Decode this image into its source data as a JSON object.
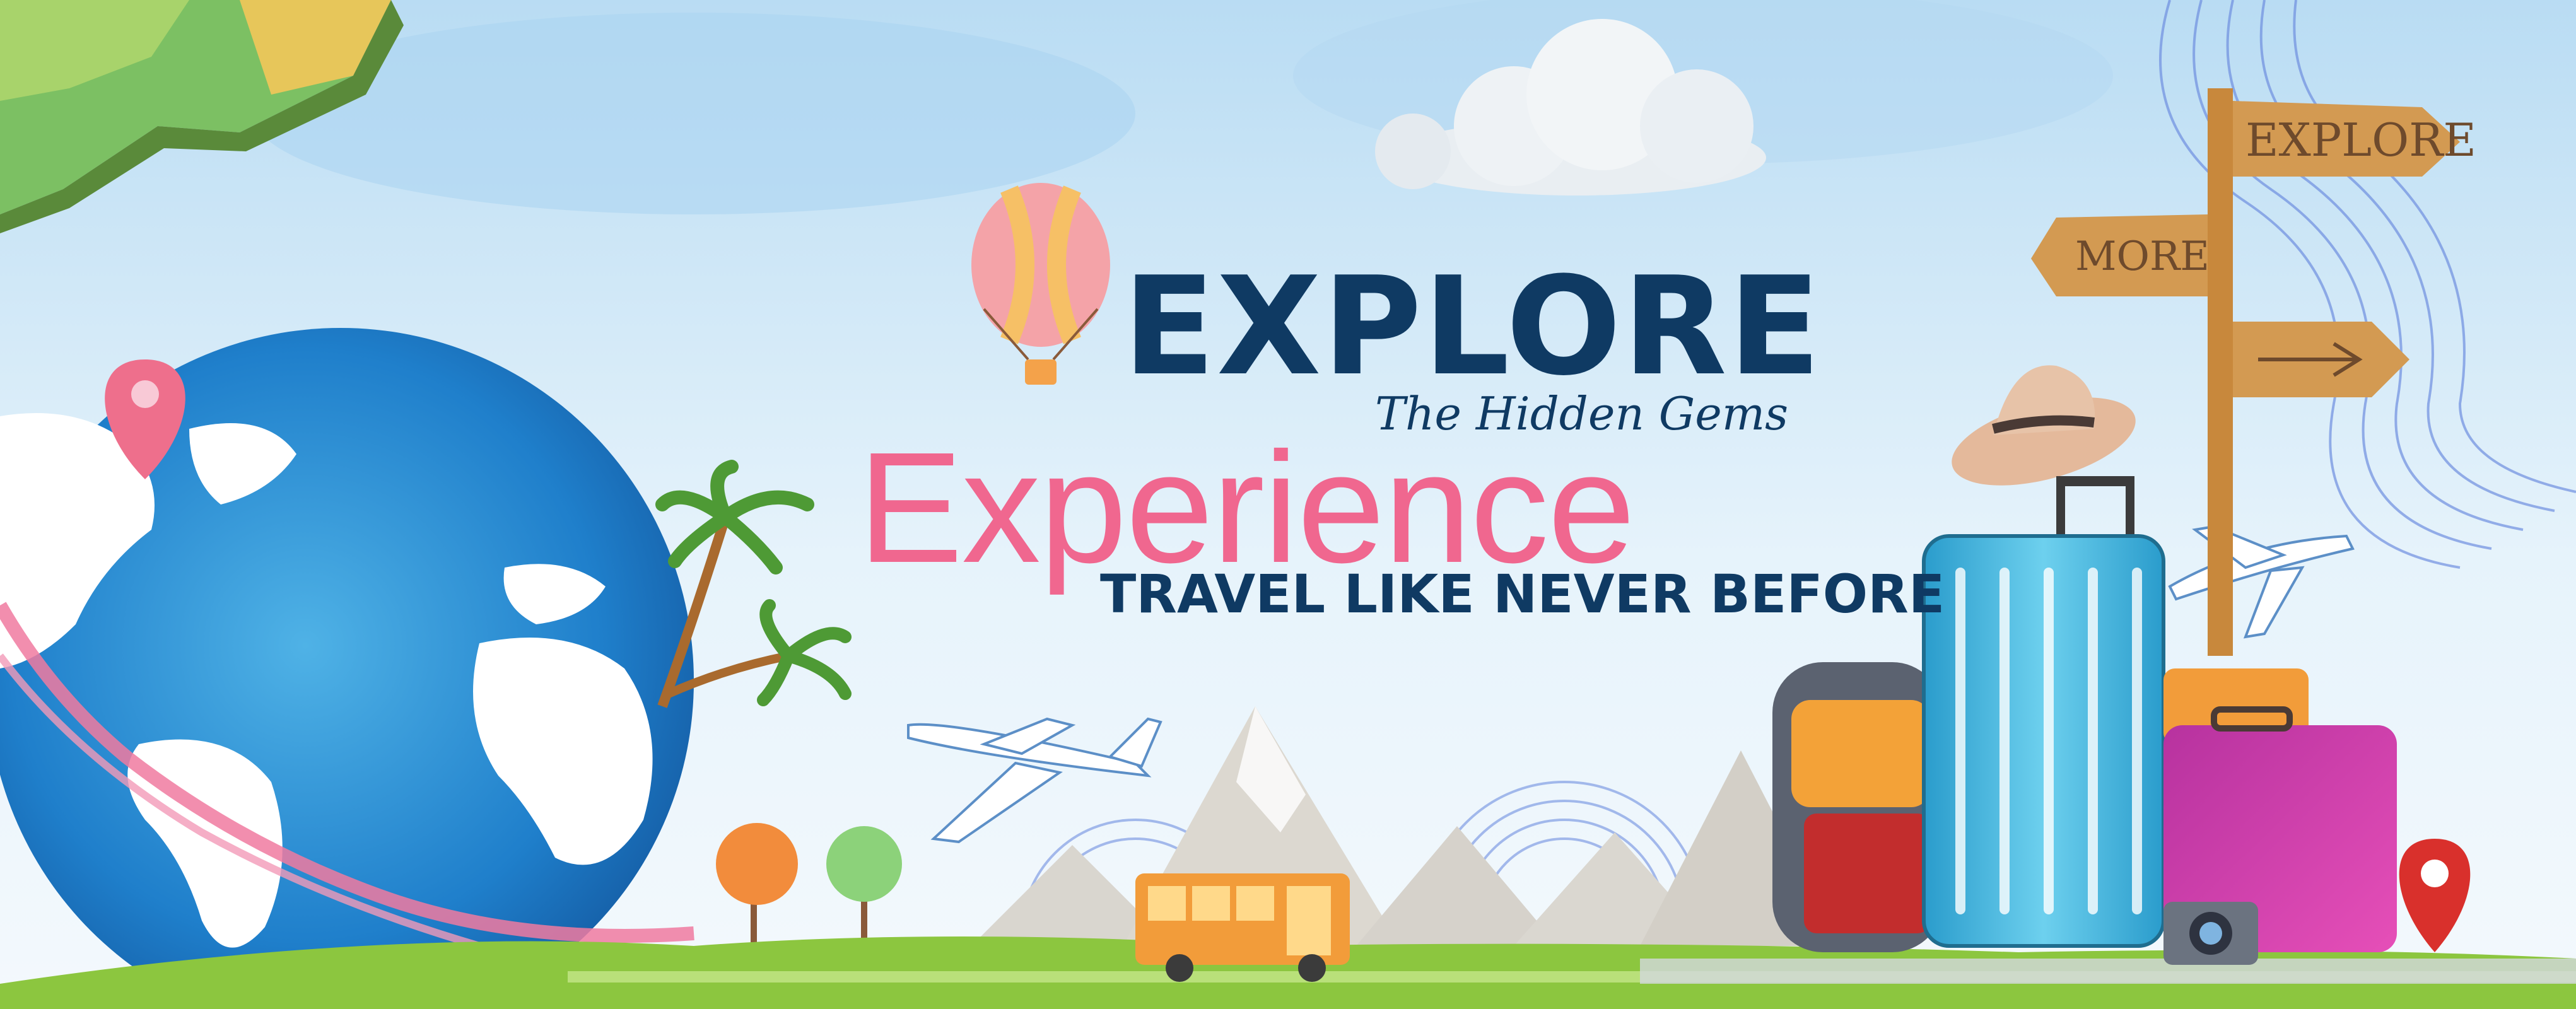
{
  "headline": "EXPLORE",
  "tagline": "The Hidden Gems",
  "subhead": "Experience",
  "caption": "TRAVEL LIKE NEVER BEFORE",
  "signpost": {
    "top": "EXPLORE",
    "middle": "MORE"
  },
  "colors": {
    "navy": "#0f3a63",
    "pink": "#f0678f",
    "sky": "#cfe6f7",
    "grass": "#8cc63f"
  }
}
